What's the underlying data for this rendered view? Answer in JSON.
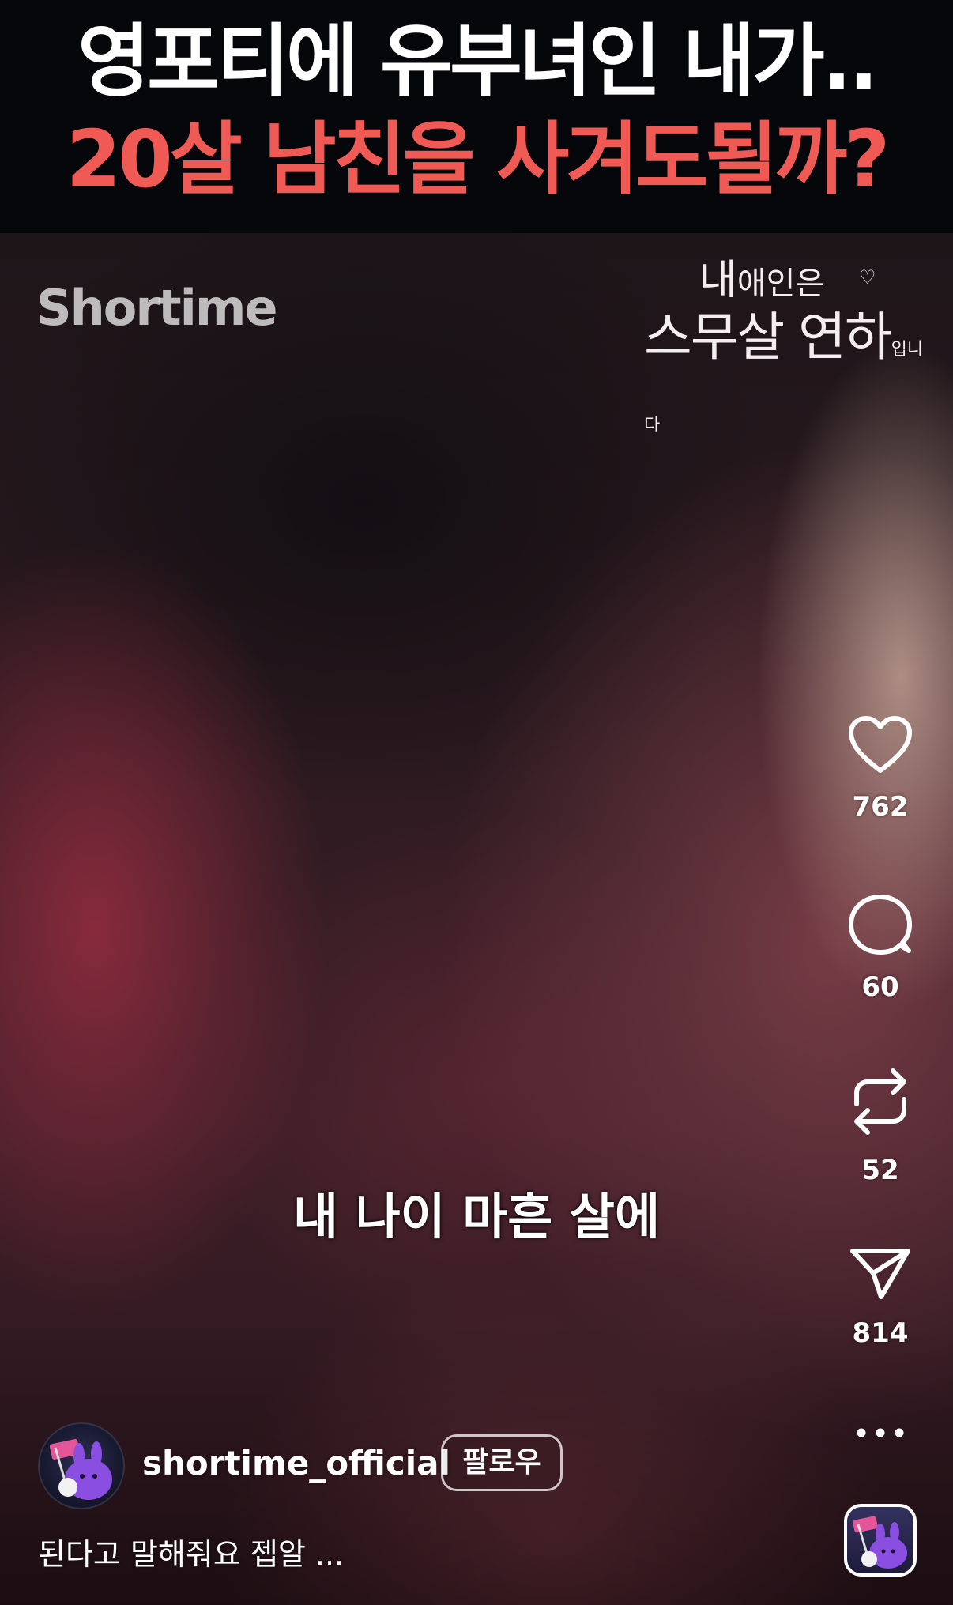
{
  "banner": {
    "line1": "영포티에 유부녀인 내가..",
    "line2": "20살 남친을 사겨도될까?",
    "line2_color": "#ef5a55"
  },
  "video": {
    "watermark": "Shortime",
    "series_logo": {
      "line1_big": "내",
      "line1_rest": "애인은",
      "line2_a": "스무살 연하",
      "line2_b": "입니다"
    },
    "subtitle": "내 나이 마흔 살에"
  },
  "actions": {
    "like": {
      "icon": "heart-icon",
      "count": "762"
    },
    "comment": {
      "icon": "comment-bubble-icon",
      "count": "60"
    },
    "repost": {
      "icon": "repost-icon",
      "count": "52"
    },
    "share": {
      "icon": "send-icon",
      "count": "814"
    },
    "more": {
      "icon": "more-dots-icon"
    }
  },
  "account": {
    "username": "shortime_official",
    "follow_label": "팔로우",
    "caption": "된다고 말해줘요 젭알 ..."
  },
  "colors": {
    "accent_red": "#ef5a55",
    "mascot_purple": "#8a4fe0",
    "flag_pink": "#e3579a"
  }
}
